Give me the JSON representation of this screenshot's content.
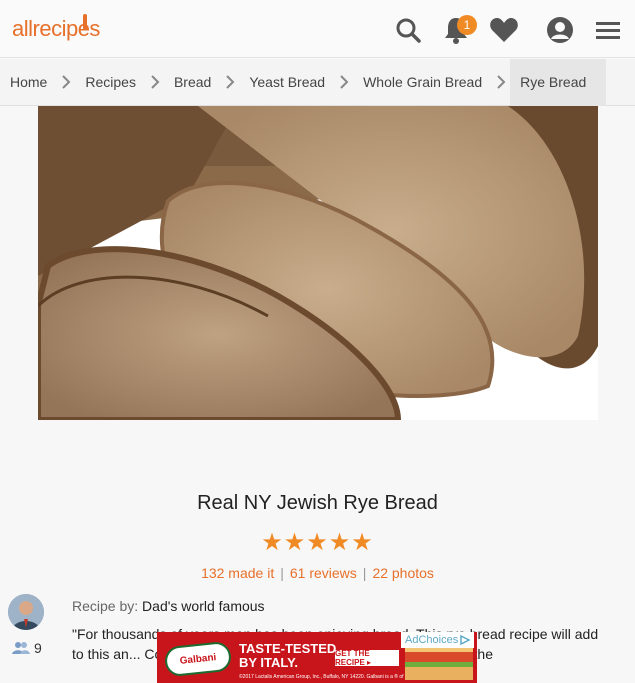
{
  "header": {
    "logo_text": "allrecipes",
    "notification_count": "1",
    "icons": [
      "search-icon",
      "bell-icon",
      "heart-icon",
      "user-icon",
      "menu-icon"
    ],
    "accent_color": "#e7702a"
  },
  "breadcrumb": {
    "items": [
      {
        "label": "Home"
      },
      {
        "label": "Recipes"
      },
      {
        "label": "Bread"
      },
      {
        "label": "Yeast Bread"
      },
      {
        "label": "Whole Grain Bread"
      },
      {
        "label": "Rye Bread"
      }
    ]
  },
  "recipe": {
    "title": "Real NY Jewish Rye Bread",
    "rating": 5,
    "rating_max": 5,
    "made_it": "132 made it",
    "reviews": "61 reviews",
    "photos": "22 photos",
    "author_prefix": "Recipe by:",
    "author": "Dad's world famous",
    "followers": "9",
    "description": "\"For thousands of years man has been enjoying bread. This rye bread recipe will add to this an... Connecticut for over 35 years, in clos... king some of the"
  },
  "ad": {
    "brand": "Galbani",
    "headline_line1": "TASTE-TESTED",
    "headline_line2": "BY ITALY.",
    "button": "GET THE RECIPE ▸",
    "fine_print": "©2017 Lactalis American Group, Inc., Buffalo, NY 14220. Galbani is a ® of Egidio Galbani S.r.l.",
    "adchoices": "AdChoices"
  }
}
